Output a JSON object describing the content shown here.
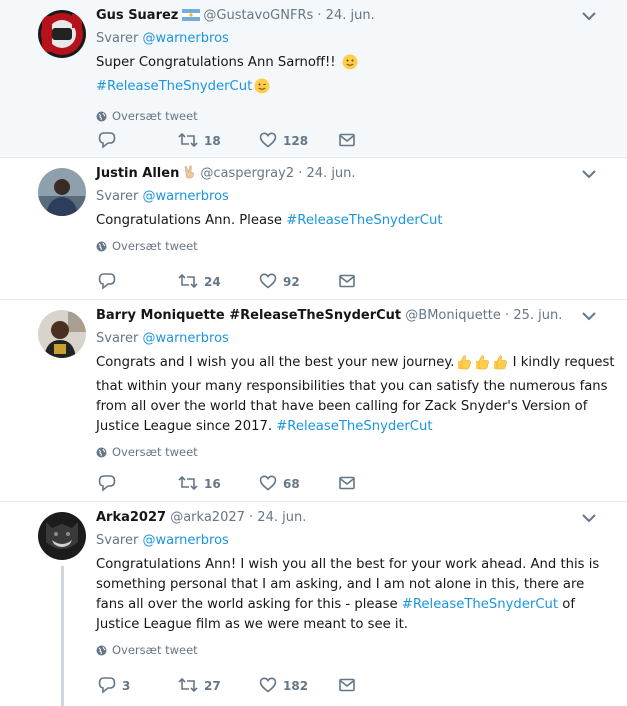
{
  "tweets": [
    {
      "name": "Gus Suarez",
      "handle": "@GustavoGNFRs",
      "date": "24. jun.",
      "reply_prefix": "Svarer",
      "reply_to": "@warnerbros",
      "text_before": "Super Congratulations Ann Sarnoff!! ",
      "hashtag": "#ReleaseTheSnyderCut",
      "text_after": "",
      "translate": "Oversæt tweet",
      "replies": "",
      "retweets": "18",
      "likes": "128"
    },
    {
      "name": "Justin Allen",
      "handle": "@caspergray2",
      "date": "24. jun.",
      "reply_prefix": "Svarer",
      "reply_to": "@warnerbros",
      "text_before": "Congratulations Ann. Please ",
      "hashtag": "#ReleaseTheSnyderCut",
      "text_after": "",
      "translate": "Oversæt tweet",
      "replies": "",
      "retweets": "24",
      "likes": "92"
    },
    {
      "name": "Barry Moniquette #ReleaseTheSnyderCut",
      "handle": "@BMoniquette",
      "date": "25. jun.",
      "reply_prefix": "Svarer",
      "reply_to": "@warnerbros",
      "text_before": "Congrats and I wish you all the best your new journey.",
      "text_middle": "I kindly request that within your many responsibilities that you can satisfy the numerous fans from all over the world that have been calling for Zack Snyder's Version of Justice League since 2017. ",
      "hashtag": "#ReleaseTheSnyderCut",
      "text_after": "",
      "translate": "Oversæt tweet",
      "replies": "",
      "retweets": "16",
      "likes": "68"
    },
    {
      "name": "Arka2027",
      "handle": "@arka2027",
      "date": "24. jun.",
      "reply_prefix": "Svarer",
      "reply_to": "@warnerbros",
      "text_before": "Congratulations Ann! I wish you all the best for your work ahead. And this is something personal that I am asking, and I am not alone in this, there are fans all over the world asking for this - please ",
      "hashtag": "#ReleaseTheSnyderCut",
      "text_after": " of Justice League film as we were meant to see it.",
      "translate": "Oversæt tweet",
      "replies": "3",
      "retweets": "27",
      "likes": "182"
    }
  ],
  "colors": {
    "link": "#1b95e0",
    "muted": "#657786",
    "text": "#14171a",
    "highlight_bg": "#f5f8fa",
    "thread_line": "#ccd6dd"
  },
  "icons": [
    "reply-icon",
    "retweet-icon",
    "like-icon",
    "direct-message-icon",
    "globe-icon",
    "chevron-down-icon",
    "argentina-flag-icon",
    "victory-hand-icon",
    "slightly-smiling-face-emoji",
    "winking-face-emoji",
    "thumbs-up-emoji"
  ]
}
